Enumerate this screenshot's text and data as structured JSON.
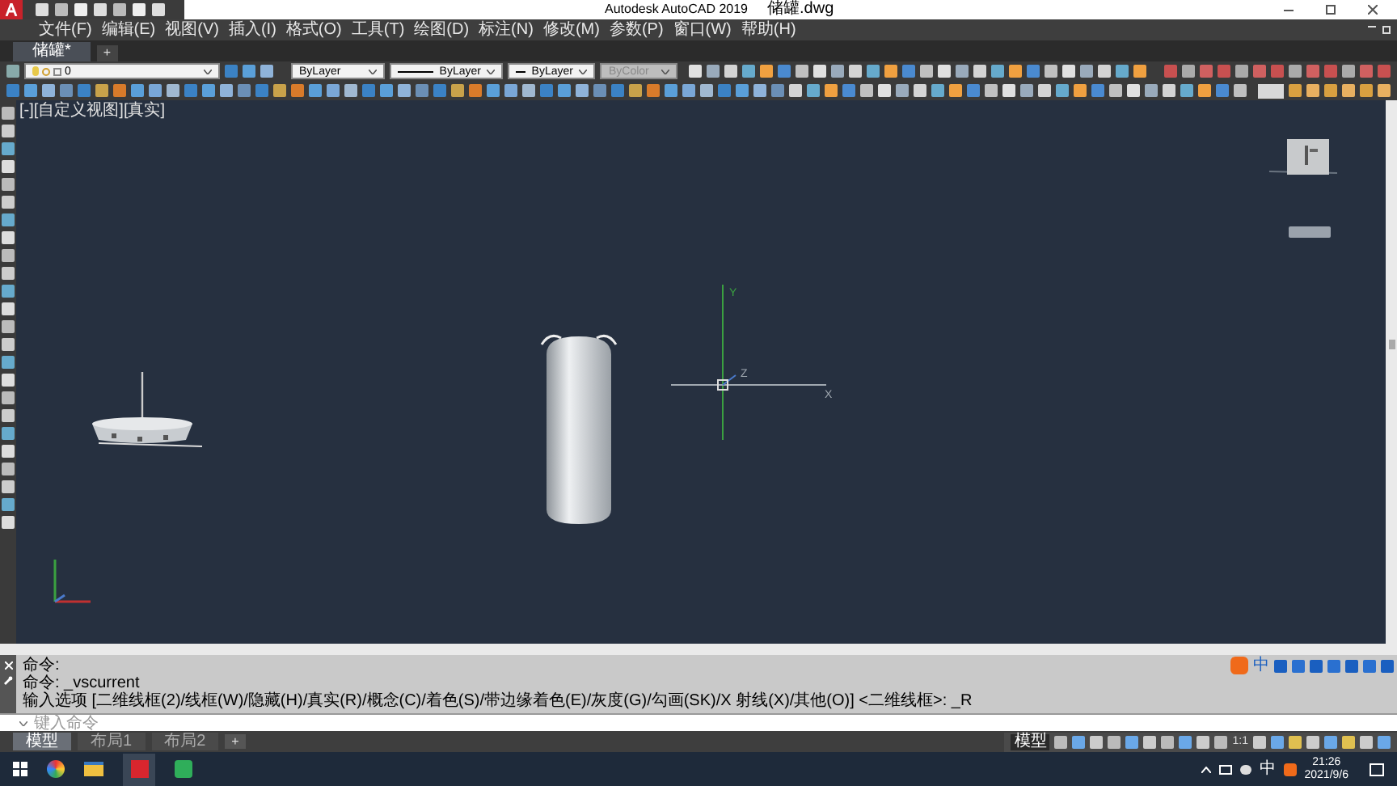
{
  "title_bar": {
    "app_title": "Autodesk AutoCAD 2019",
    "file_name": "储罐.dwg"
  },
  "menu": [
    "文件(F)",
    "编辑(E)",
    "视图(V)",
    "插入(I)",
    "格式(O)",
    "工具(T)",
    "绘图(D)",
    "标注(N)",
    "修改(M)",
    "参数(P)",
    "窗口(W)",
    "帮助(H)"
  ],
  "file_tabs": [
    {
      "label": "储罐*",
      "selected": true
    }
  ],
  "new_tab": "+",
  "properties_toolbar": {
    "layer": "0",
    "color_setting": "ByLayer",
    "linetype": "ByLayer",
    "lineweight": "ByLayer",
    "plot_style": {
      "value": "ByColor",
      "disabled": true
    }
  },
  "viewport": {
    "label": "[-][自定义视图][真实]",
    "axis_labels": {
      "y": "Y",
      "z": "Z",
      "x": "X"
    }
  },
  "command_history": [
    "命令:",
    "命令: _vscurrent",
    "输入选项 [二维线框(2)/线框(W)/隐藏(H)/真实(R)/概念(C)/着色(S)/带边缘着色(E)/灰度(G)/勾画(SK)/X 射线(X)/其他(O)] <二维线框>: _R"
  ],
  "command_input": {
    "placeholder": "键入命令"
  },
  "layout_tabs": [
    {
      "label": "模型",
      "selected": true
    },
    {
      "label": "布局1",
      "selected": false
    },
    {
      "label": "布局2",
      "selected": false
    }
  ],
  "layout_add": "+",
  "status_bar": {
    "space": "模型",
    "scale": "1:1"
  },
  "ime_bar": {
    "mode": "中"
  },
  "taskbar": {
    "ime": "中",
    "time": "21:26",
    "date": "2021/9/6"
  }
}
